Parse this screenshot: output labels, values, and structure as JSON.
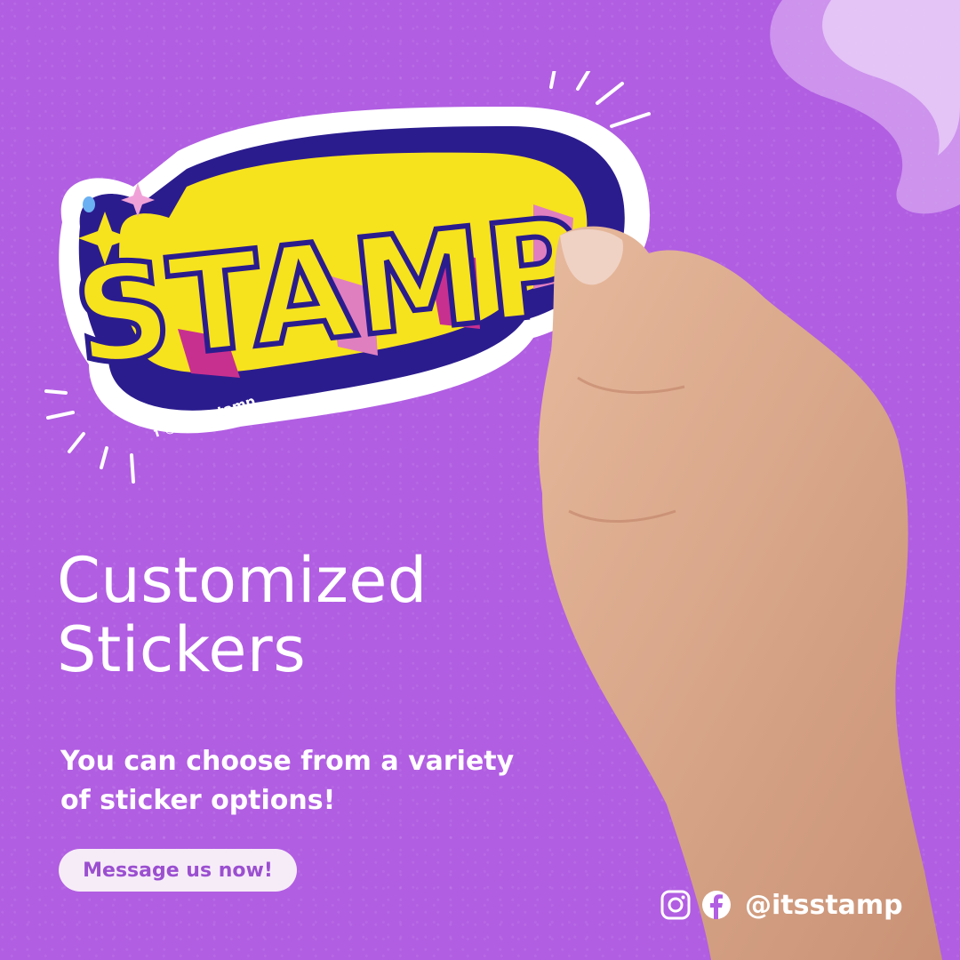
{
  "colors": {
    "background": "#b15ee2",
    "cta_bg": "#f6ecf8",
    "cta_text": "#9b4fd0",
    "sticker_yellow": "#f7e21e",
    "sticker_outline": "#2b1c8e",
    "sticker_magenta": "#c8308f",
    "sticker_pink": "#e07fc0"
  },
  "sticker": {
    "word": "STAMP",
    "small_handle": "@itsstamp"
  },
  "headline": {
    "line1": "Customized",
    "line2": "Stickers"
  },
  "subtitle": "You can choose from a variety of sticker options!",
  "cta_label": "Message us now!",
  "social": {
    "icons": [
      "instagram-icon",
      "facebook-icon"
    ],
    "handle": "@itsstamp"
  }
}
